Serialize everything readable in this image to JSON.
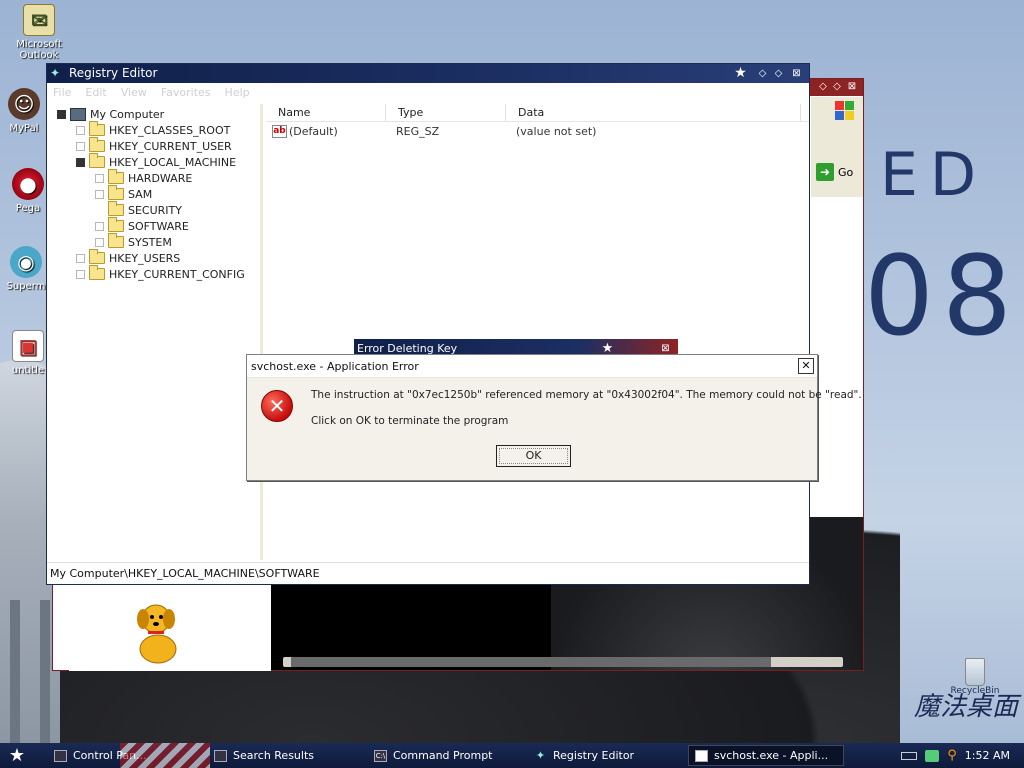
{
  "desktop": {
    "icons": [
      {
        "label": "Microsoft Outlook",
        "icon": "outlook-icon"
      },
      {
        "label": "MyPal",
        "icon": "mypal-icon"
      },
      {
        "label": "Pega",
        "icon": "pega-icon"
      },
      {
        "label": "Superm",
        "icon": "superm-icon"
      },
      {
        "label": "untitle",
        "icon": "paint-icon"
      }
    ],
    "big_text_1": "ED",
    "big_text_2": "08",
    "logo_text": "魔法桌面",
    "recycle_label": "RecycleBin"
  },
  "back_window": {
    "go_label": "Go",
    "controls": [
      "◇",
      "◇",
      "⊠"
    ]
  },
  "registry": {
    "title": "Registry Editor",
    "menu": [
      "File",
      "Edit",
      "View",
      "Favorites",
      "Help"
    ],
    "tree": {
      "root": "My Computer",
      "items": [
        "HKEY_CLASSES_ROOT",
        "HKEY_CURRENT_USER",
        "HKEY_LOCAL_MACHINE",
        "HARDWARE",
        "SAM",
        "SECURITY",
        "SOFTWARE",
        "SYSTEM",
        "HKEY_USERS",
        "HKEY_CURRENT_CONFIG"
      ]
    },
    "columns": {
      "name": "Name",
      "type": "Type",
      "data": "Data"
    },
    "rows": [
      {
        "name": "(Default)",
        "type": "REG_SZ",
        "data": "(value not set)"
      }
    ],
    "status": "My Computer\\HKEY_LOCAL_MACHINE\\SOFTWARE"
  },
  "error_deleting": {
    "title": "Error Deleting Key"
  },
  "app_error": {
    "title": "svchost.exe - Application Error",
    "message": "The instruction at \"0x7ec1250b\" referenced memory at \"0x43002f04\". The memory could not be \"read\".",
    "sub": "Click on OK to terminate the program",
    "ok": "OK",
    "close": "✕"
  },
  "taskbar": {
    "tasks": [
      {
        "label": "Control Pan...",
        "icon": "control-panel-icon"
      },
      {
        "label": "Search Results",
        "icon": "search-results-icon"
      },
      {
        "label": "Command Prompt",
        "icon": "cmd-icon"
      },
      {
        "label": "Registry Editor",
        "icon": "regedit-icon"
      },
      {
        "label": "svchost.exe - Appli...",
        "icon": "window-icon"
      }
    ],
    "clock": "1:52 AM"
  },
  "colors": {
    "title_bar": "#10204a",
    "error_red": "#c40d0d",
    "taskbar": "#0e1a3a"
  }
}
